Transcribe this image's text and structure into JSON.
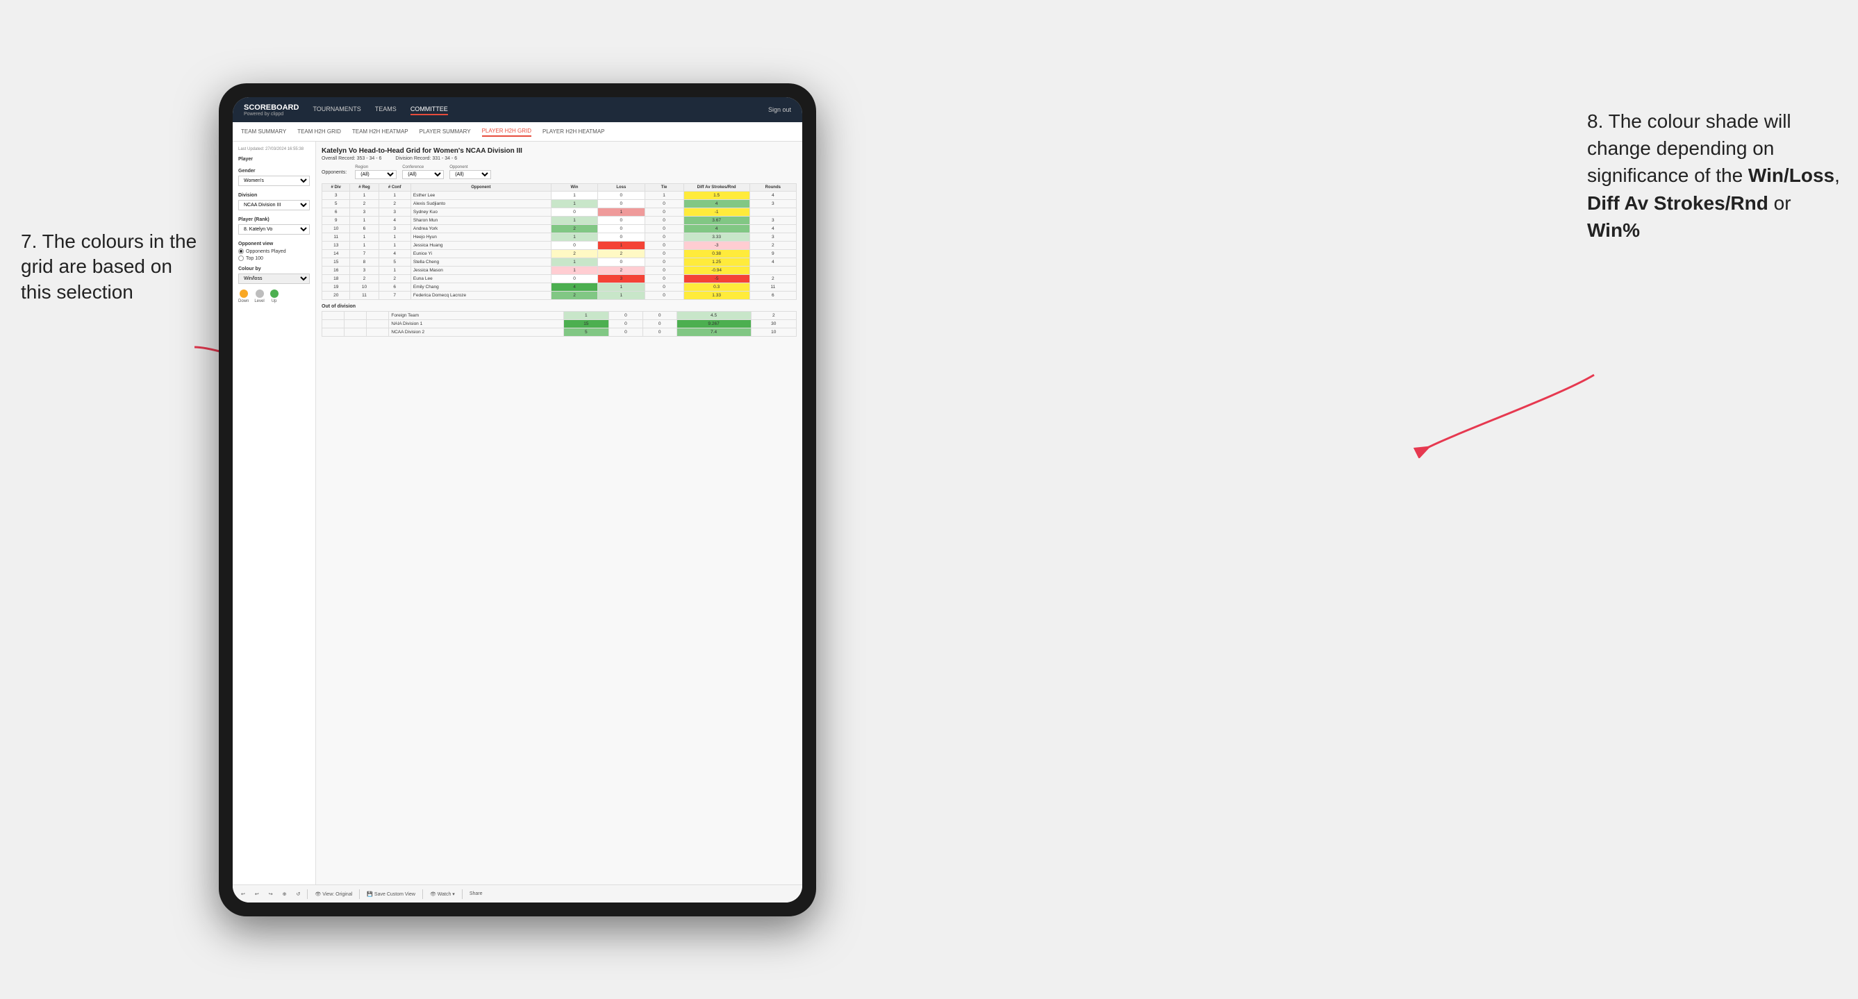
{
  "annotations": {
    "left_title": "7. The colours in the grid are based on this selection",
    "right_title": "8. The colour shade will change depending on significance of the ",
    "right_bold1": "Win/Loss",
    "right_comma": ", ",
    "right_bold2": "Diff Av Strokes/Rnd",
    "right_or": " or",
    "right_bold3": "Win%"
  },
  "nav": {
    "logo": "SCOREBOARD",
    "logo_sub": "Powered by clippd",
    "links": [
      "TOURNAMENTS",
      "TEAMS",
      "COMMITTEE"
    ],
    "active_link": "COMMITTEE",
    "sign_out": "Sign out"
  },
  "sub_nav": {
    "links": [
      "TEAM SUMMARY",
      "TEAM H2H GRID",
      "TEAM H2H HEATMAP",
      "PLAYER SUMMARY",
      "PLAYER H2H GRID",
      "PLAYER H2H HEATMAP"
    ],
    "active_link": "PLAYER H2H GRID"
  },
  "sidebar": {
    "timestamp": "Last Updated: 27/03/2024 16:55:38",
    "player_section": "Player",
    "gender_label": "Gender",
    "gender_value": "Women's",
    "division_label": "Division",
    "division_value": "NCAA Division III",
    "player_rank_label": "Player (Rank)",
    "player_rank_value": "8. Katelyn Vo",
    "opponent_view_label": "Opponent view",
    "radio1": "Opponents Played",
    "radio2": "Top 100",
    "colour_by_label": "Colour by",
    "colour_by_value": "Win/loss",
    "legend_down": "Down",
    "legend_level": "Level",
    "legend_up": "Up"
  },
  "grid": {
    "title": "Katelyn Vo Head-to-Head Grid for Women's NCAA Division III",
    "overall_record_label": "Overall Record:",
    "overall_record": "353 - 34 - 6",
    "division_record_label": "Division Record:",
    "division_record": "331 - 34 - 6",
    "opponents_label": "Opponents:",
    "filters": {
      "region_label": "Region",
      "region_value": "(All)",
      "conference_label": "Conference",
      "conference_value": "(All)",
      "opponent_label": "Opponent",
      "opponent_value": "(All)"
    },
    "table_headers": {
      "div": "#\nDiv",
      "reg": "#\nReg",
      "conf": "#\nConf",
      "opponent": "Opponent",
      "win": "Win",
      "loss": "Loss",
      "tie": "Tie",
      "diff": "Diff Av\nStrokes/Rnd",
      "rounds": "Rounds"
    },
    "rows": [
      {
        "div": 3,
        "reg": 1,
        "conf": 1,
        "opponent": "Esther Lee",
        "win": 1,
        "loss": 0,
        "tie": 1,
        "diff": 1.5,
        "rounds": 4,
        "win_color": "neutral",
        "loss_color": "neutral",
        "diff_color": "yellow"
      },
      {
        "div": 5,
        "reg": 2,
        "conf": 2,
        "opponent": "Alexis Sudjianto",
        "win": 1,
        "loss": 0,
        "tie": 0,
        "diff": 4.0,
        "rounds": 3,
        "win_color": "win-light",
        "loss_color": "neutral",
        "diff_color": "win-light"
      },
      {
        "div": 6,
        "reg": 3,
        "conf": 3,
        "opponent": "Sydney Kuo",
        "win": 0,
        "loss": 1,
        "tie": 0,
        "diff": -1.0,
        "rounds": "",
        "win_color": "neutral",
        "loss_color": "loss-med",
        "diff_color": "loss-light"
      },
      {
        "div": 9,
        "reg": 1,
        "conf": 4,
        "opponent": "Sharon Mun",
        "win": 1,
        "loss": 0,
        "tie": 0,
        "diff": 3.67,
        "rounds": 3,
        "win_color": "win-light",
        "loss_color": "neutral",
        "diff_color": "win-light"
      },
      {
        "div": 10,
        "reg": 6,
        "conf": 3,
        "opponent": "Andrea York",
        "win": 2,
        "loss": 0,
        "tie": 0,
        "diff": 4.0,
        "rounds": 4,
        "win_color": "win-med",
        "loss_color": "neutral",
        "diff_color": "win-light"
      },
      {
        "div": 11,
        "reg": 1,
        "conf": 1,
        "opponent": "Heejo Hyun",
        "win": 1,
        "loss": 0,
        "tie": 0,
        "diff": 3.33,
        "rounds": 3,
        "win_color": "win-light",
        "loss_color": "neutral",
        "diff_color": "win-light"
      },
      {
        "div": 13,
        "reg": 1,
        "conf": 1,
        "opponent": "Jessica Huang",
        "win": 0,
        "loss": 1,
        "tie": 0,
        "diff": -3.0,
        "rounds": 2,
        "win_color": "neutral",
        "loss_color": "loss-dark",
        "diff_color": "loss-med"
      },
      {
        "div": 14,
        "reg": 7,
        "conf": 4,
        "opponent": "Eunice Yi",
        "win": 2,
        "loss": 2,
        "tie": 0,
        "diff": 0.38,
        "rounds": 9,
        "win_color": "yellow-light",
        "loss_color": "yellow-light",
        "diff_color": "yellow"
      },
      {
        "div": 15,
        "reg": 8,
        "conf": 5,
        "opponent": "Stella Cheng",
        "win": 1,
        "loss": 0,
        "tie": 0,
        "diff": 1.25,
        "rounds": 4,
        "win_color": "win-light",
        "loss_color": "neutral",
        "diff_color": "yellow"
      },
      {
        "div": 16,
        "reg": 3,
        "conf": 1,
        "opponent": "Jessica Mason",
        "win": 1,
        "loss": 2,
        "tie": 0,
        "diff": -0.94,
        "rounds": "",
        "win_color": "loss-light",
        "loss_color": "loss-light",
        "diff_color": "loss-light"
      },
      {
        "div": 18,
        "reg": 2,
        "conf": 2,
        "opponent": "Euna Lee",
        "win": 0,
        "loss": 3,
        "tie": 0,
        "diff": -5.0,
        "rounds": 2,
        "win_color": "neutral",
        "loss_color": "loss-dark",
        "diff_color": "loss-dark"
      },
      {
        "div": 19,
        "reg": 10,
        "conf": 6,
        "opponent": "Emily Chang",
        "win": 4,
        "loss": 1,
        "tie": 0,
        "diff": 0.3,
        "rounds": 11,
        "win_color": "win-dark",
        "loss_color": "win-light",
        "diff_color": "yellow"
      },
      {
        "div": 20,
        "reg": 11,
        "conf": 7,
        "opponent": "Federica Domecq Lacroze",
        "win": 2,
        "loss": 1,
        "tie": 0,
        "diff": 1.33,
        "rounds": 6,
        "win_color": "win-med",
        "loss_color": "win-light",
        "diff_color": "yellow"
      }
    ],
    "out_of_division_label": "Out of division",
    "out_rows": [
      {
        "name": "Foreign Team",
        "win": 1,
        "loss": 0,
        "tie": 0,
        "diff": 4.5,
        "rounds": 2,
        "win_color": "win-light"
      },
      {
        "name": "NAIA Division 1",
        "win": 15,
        "loss": 0,
        "tie": 0,
        "diff": 9.267,
        "rounds": 30,
        "win_color": "win-dark"
      },
      {
        "name": "NCAA Division 2",
        "win": 5,
        "loss": 0,
        "tie": 0,
        "diff": 7.4,
        "rounds": 10,
        "win_color": "win-med"
      }
    ]
  },
  "toolbar": {
    "buttons": [
      "↩",
      "↩",
      "↪",
      "⊕",
      "↩",
      "·",
      "↺",
      "|",
      "👁 View: Original",
      "|",
      "💾 Save Custom View",
      "|",
      "👁 Watch ▾",
      "|",
      "⊡",
      "⊞",
      "Share"
    ]
  }
}
